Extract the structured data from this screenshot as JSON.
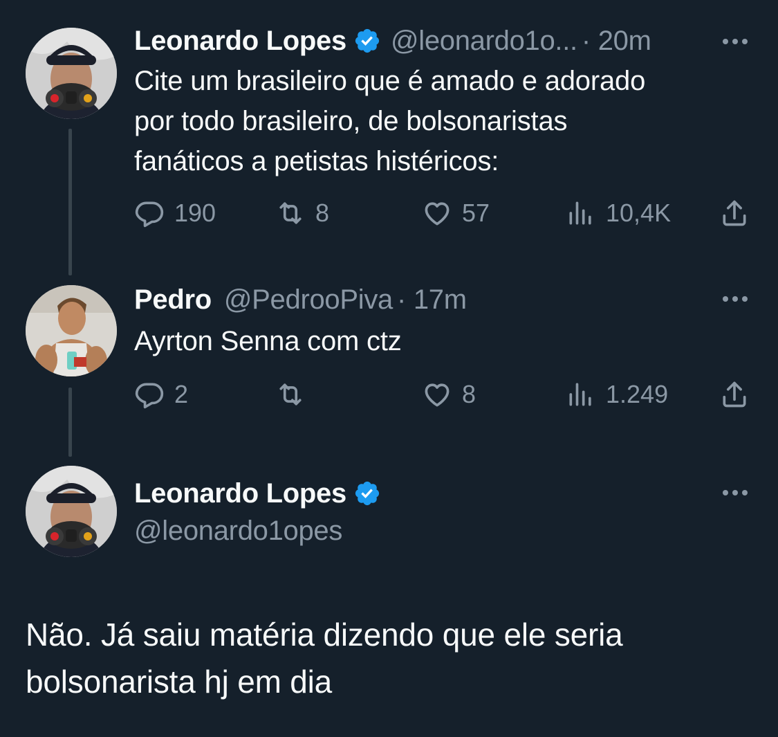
{
  "tweet1": {
    "name": "Leonardo Lopes",
    "handle": "@leonardo1o...",
    "time": "· 20m",
    "lines": [
      "Cite um brasileiro que é amado e adorado",
      "por todo brasileiro, de bolsonaristas",
      "fanáticos a petistas histéricos:"
    ],
    "replies": "190",
    "retweets": "8",
    "likes": "57",
    "views": "10,4K"
  },
  "tweet2": {
    "name": "Pedro",
    "handle": "@PedrooPiva",
    "time": "· 17m",
    "text": "Ayrton Senna com ctz",
    "replies": "2",
    "retweets": "",
    "likes": "8",
    "views": "1.249"
  },
  "tweet3": {
    "name": "Leonardo Lopes",
    "handle": "@leonardo1opes",
    "lines": [
      "Não. Já saiu matéria dizendo que ele seria",
      "bolsonarista hj em dia"
    ]
  },
  "icons": {
    "reply": "reply-icon",
    "retweet": "retweet-icon",
    "like": "heart-icon",
    "views": "views-icon",
    "share": "share-icon",
    "more": "more-icon",
    "verified": "verified-icon"
  },
  "colors": {
    "background": "#15202b",
    "text": "#f7f9f9",
    "secondary": "#8b98a5",
    "verified": "#1d9bf0",
    "thread_line": "#38444d"
  }
}
